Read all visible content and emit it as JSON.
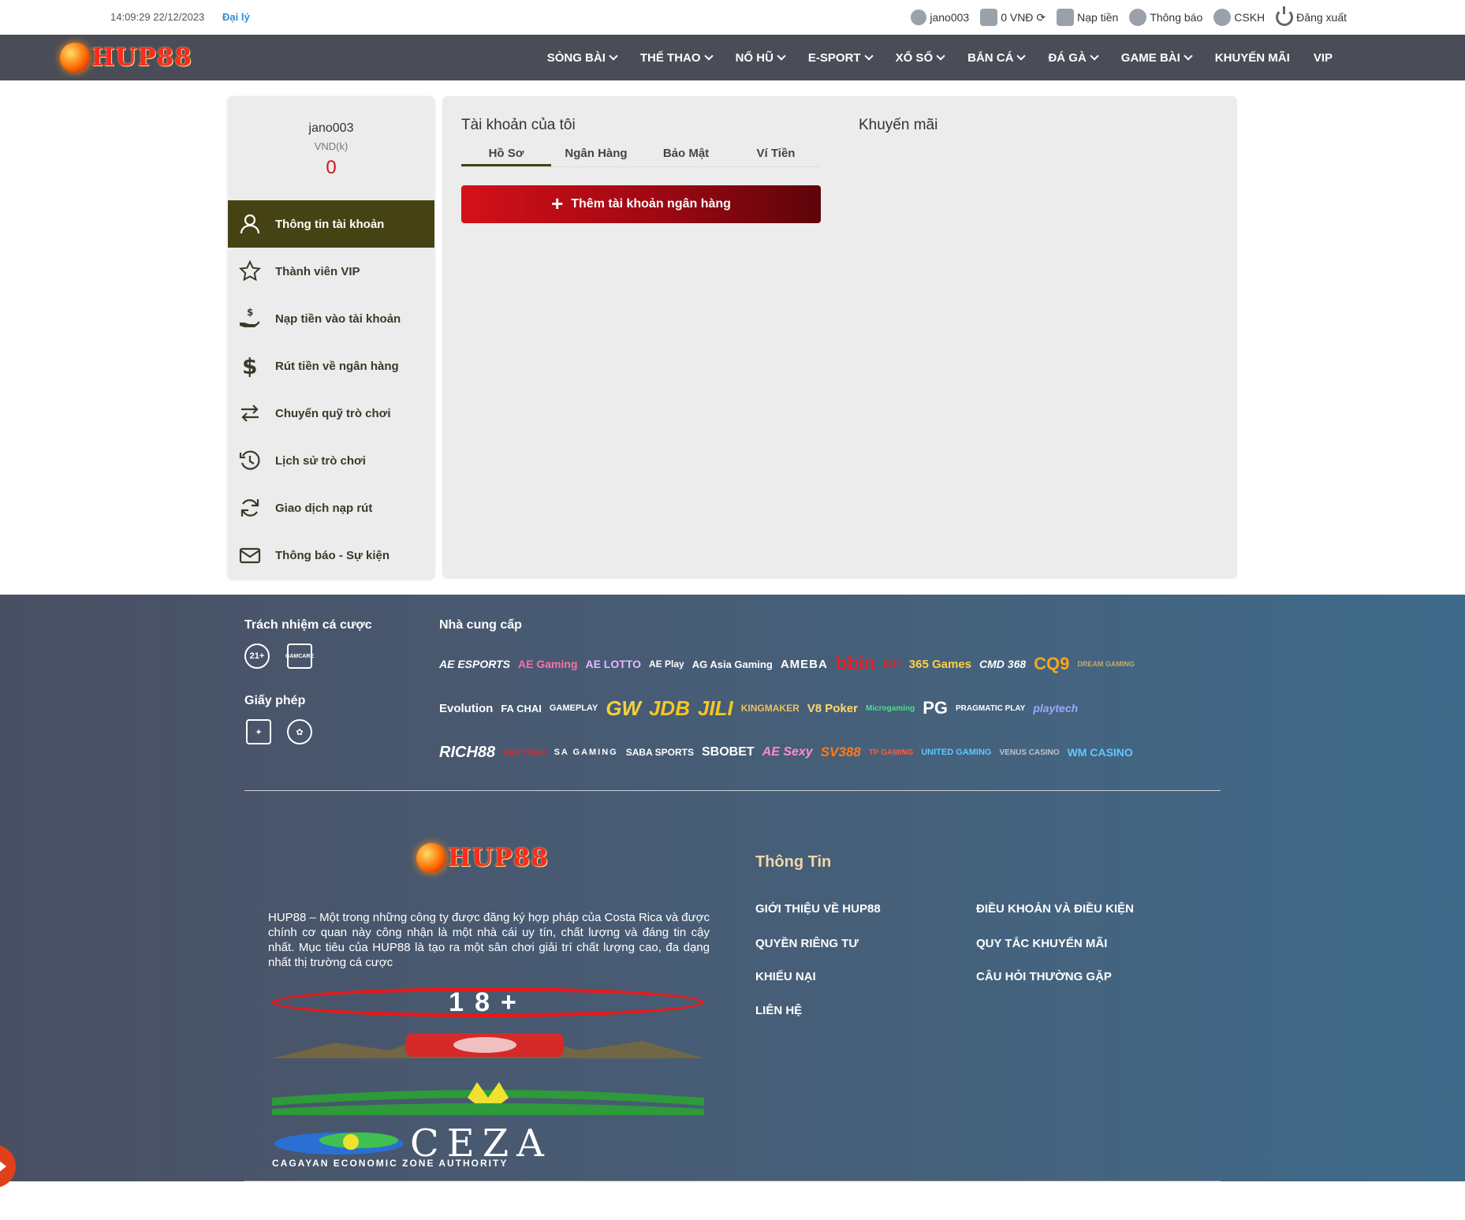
{
  "topbar": {
    "time": "14:09:29 22/12/2023",
    "agent": "Đại lý",
    "username": "jano003",
    "balance": "0 VNĐ",
    "deposit": "Nạp tiền",
    "notify": "Thông báo",
    "support": "CSKH",
    "logout": "Đăng xuất"
  },
  "brand": {
    "name": "HUP88",
    "accent": "#ff2a1a",
    "nav_bg": "#4a4c57",
    "active_bg": "#454214"
  },
  "nav": [
    {
      "label": "SÒNG BÀI",
      "dropdown": true
    },
    {
      "label": "THỂ THAO",
      "dropdown": true
    },
    {
      "label": "NỔ HŨ",
      "dropdown": true
    },
    {
      "label": "E-SPORT",
      "dropdown": true
    },
    {
      "label": "XỔ SỐ",
      "dropdown": true
    },
    {
      "label": "BẮN CÁ",
      "dropdown": true
    },
    {
      "label": "ĐÁ GÀ",
      "dropdown": true
    },
    {
      "label": "GAME BÀI",
      "dropdown": true
    },
    {
      "label": "KHUYẾN MÃI",
      "dropdown": false
    },
    {
      "label": "VIP",
      "dropdown": false
    }
  ],
  "sidebar": {
    "username": "jano003",
    "currency": "VND(k)",
    "balance": "0",
    "items": [
      {
        "label": "Thông tin tài khoản",
        "icon": "user-icon",
        "active": true
      },
      {
        "label": "Thành viên VIP",
        "icon": "star-icon",
        "active": false
      },
      {
        "label": "Nạp tiền vào tài khoản",
        "icon": "deposit-hand-icon",
        "active": false
      },
      {
        "label": "Rút tiền về ngân hàng",
        "icon": "dollar-icon",
        "active": false
      },
      {
        "label": "Chuyển quỹ trò chơi",
        "icon": "transfer-arrows-icon",
        "active": false
      },
      {
        "label": "Lịch sử trò chơi",
        "icon": "history-icon",
        "active": false
      },
      {
        "label": "Giao dịch nạp rút",
        "icon": "refresh-icon",
        "active": false
      },
      {
        "label": "Thông báo - Sự kiện",
        "icon": "envelope-icon",
        "active": false
      }
    ]
  },
  "panel": {
    "title": "Tài khoản của tôi",
    "promo_title": "Khuyến mãi",
    "tabs": [
      "Hồ Sơ",
      "Ngân Hàng",
      "Bảo Mật",
      "Ví Tiền"
    ],
    "active_tab": "Hồ Sơ",
    "add_bank_label": "Thêm tài khoản ngân hàng"
  },
  "footer": {
    "responsible_title": "Trách nhiệm cá cược",
    "responsible_badges": [
      "21+",
      "GAMCARE"
    ],
    "license_title": "Giấy phép",
    "license_badges": [
      "license-seal-icon",
      "pagcor-icon"
    ],
    "providers_title": "Nhà cung cấp",
    "providers": [
      [
        "AE ESPORTS",
        "AE Gaming",
        "AE LOTTO",
        "AE Play",
        "AG Asia Gaming",
        "AMEBA",
        "bbin",
        "BTi",
        "365 Games",
        "CMD 368",
        "CQ9",
        "DREAM GAMING"
      ],
      [
        "Evolution",
        "FA CHAI",
        "GAMEPLAY",
        "GW",
        "JDB",
        "JILI",
        "KINGMAKER",
        "V8 Poker",
        "Microgaming",
        "PG",
        "PRAGMATIC PLAY",
        "playtech"
      ],
      [
        "RICH88",
        "RED TIGER",
        "SA GAMING",
        "SABA SPORTS",
        "SBOBET",
        "AE Sexy",
        "SV388",
        "TP GAMING",
        "UNITED GAMING",
        "VENUS CASINO",
        "WM CASINO"
      ]
    ],
    "logo": "HUP88",
    "description": "HUP88 – Một trong những công ty được đăng ký hợp pháp của Costa Rica và được chính cơ quan này công nhận là một nhà cái uy tín, chất lượng và đáng tin cậy nhất. Mục tiêu của HUP88 là tạo ra một sân chơi giải trí chất lượng cao, đa dạng nhất thị trường cá cược",
    "age_badge": "18+",
    "ceza": "CEZA",
    "ceza_full": "CAGAYAN ECONOMIC ZONE AUTHORITY",
    "info_title": "Thông Tin",
    "links_left": [
      "GIỚI THIỆU VỀ HUP88",
      "QUYỀN RIÊNG TƯ",
      "KHIẾU NẠI",
      "LIÊN HỆ"
    ],
    "links_right": [
      "ĐIỀU KHOẢN VÀ ĐIỀU KIỆN",
      "QUY TẮC KHUYẾN MÃI",
      "CÂU HỎI THƯỜNG GẶP"
    ]
  }
}
